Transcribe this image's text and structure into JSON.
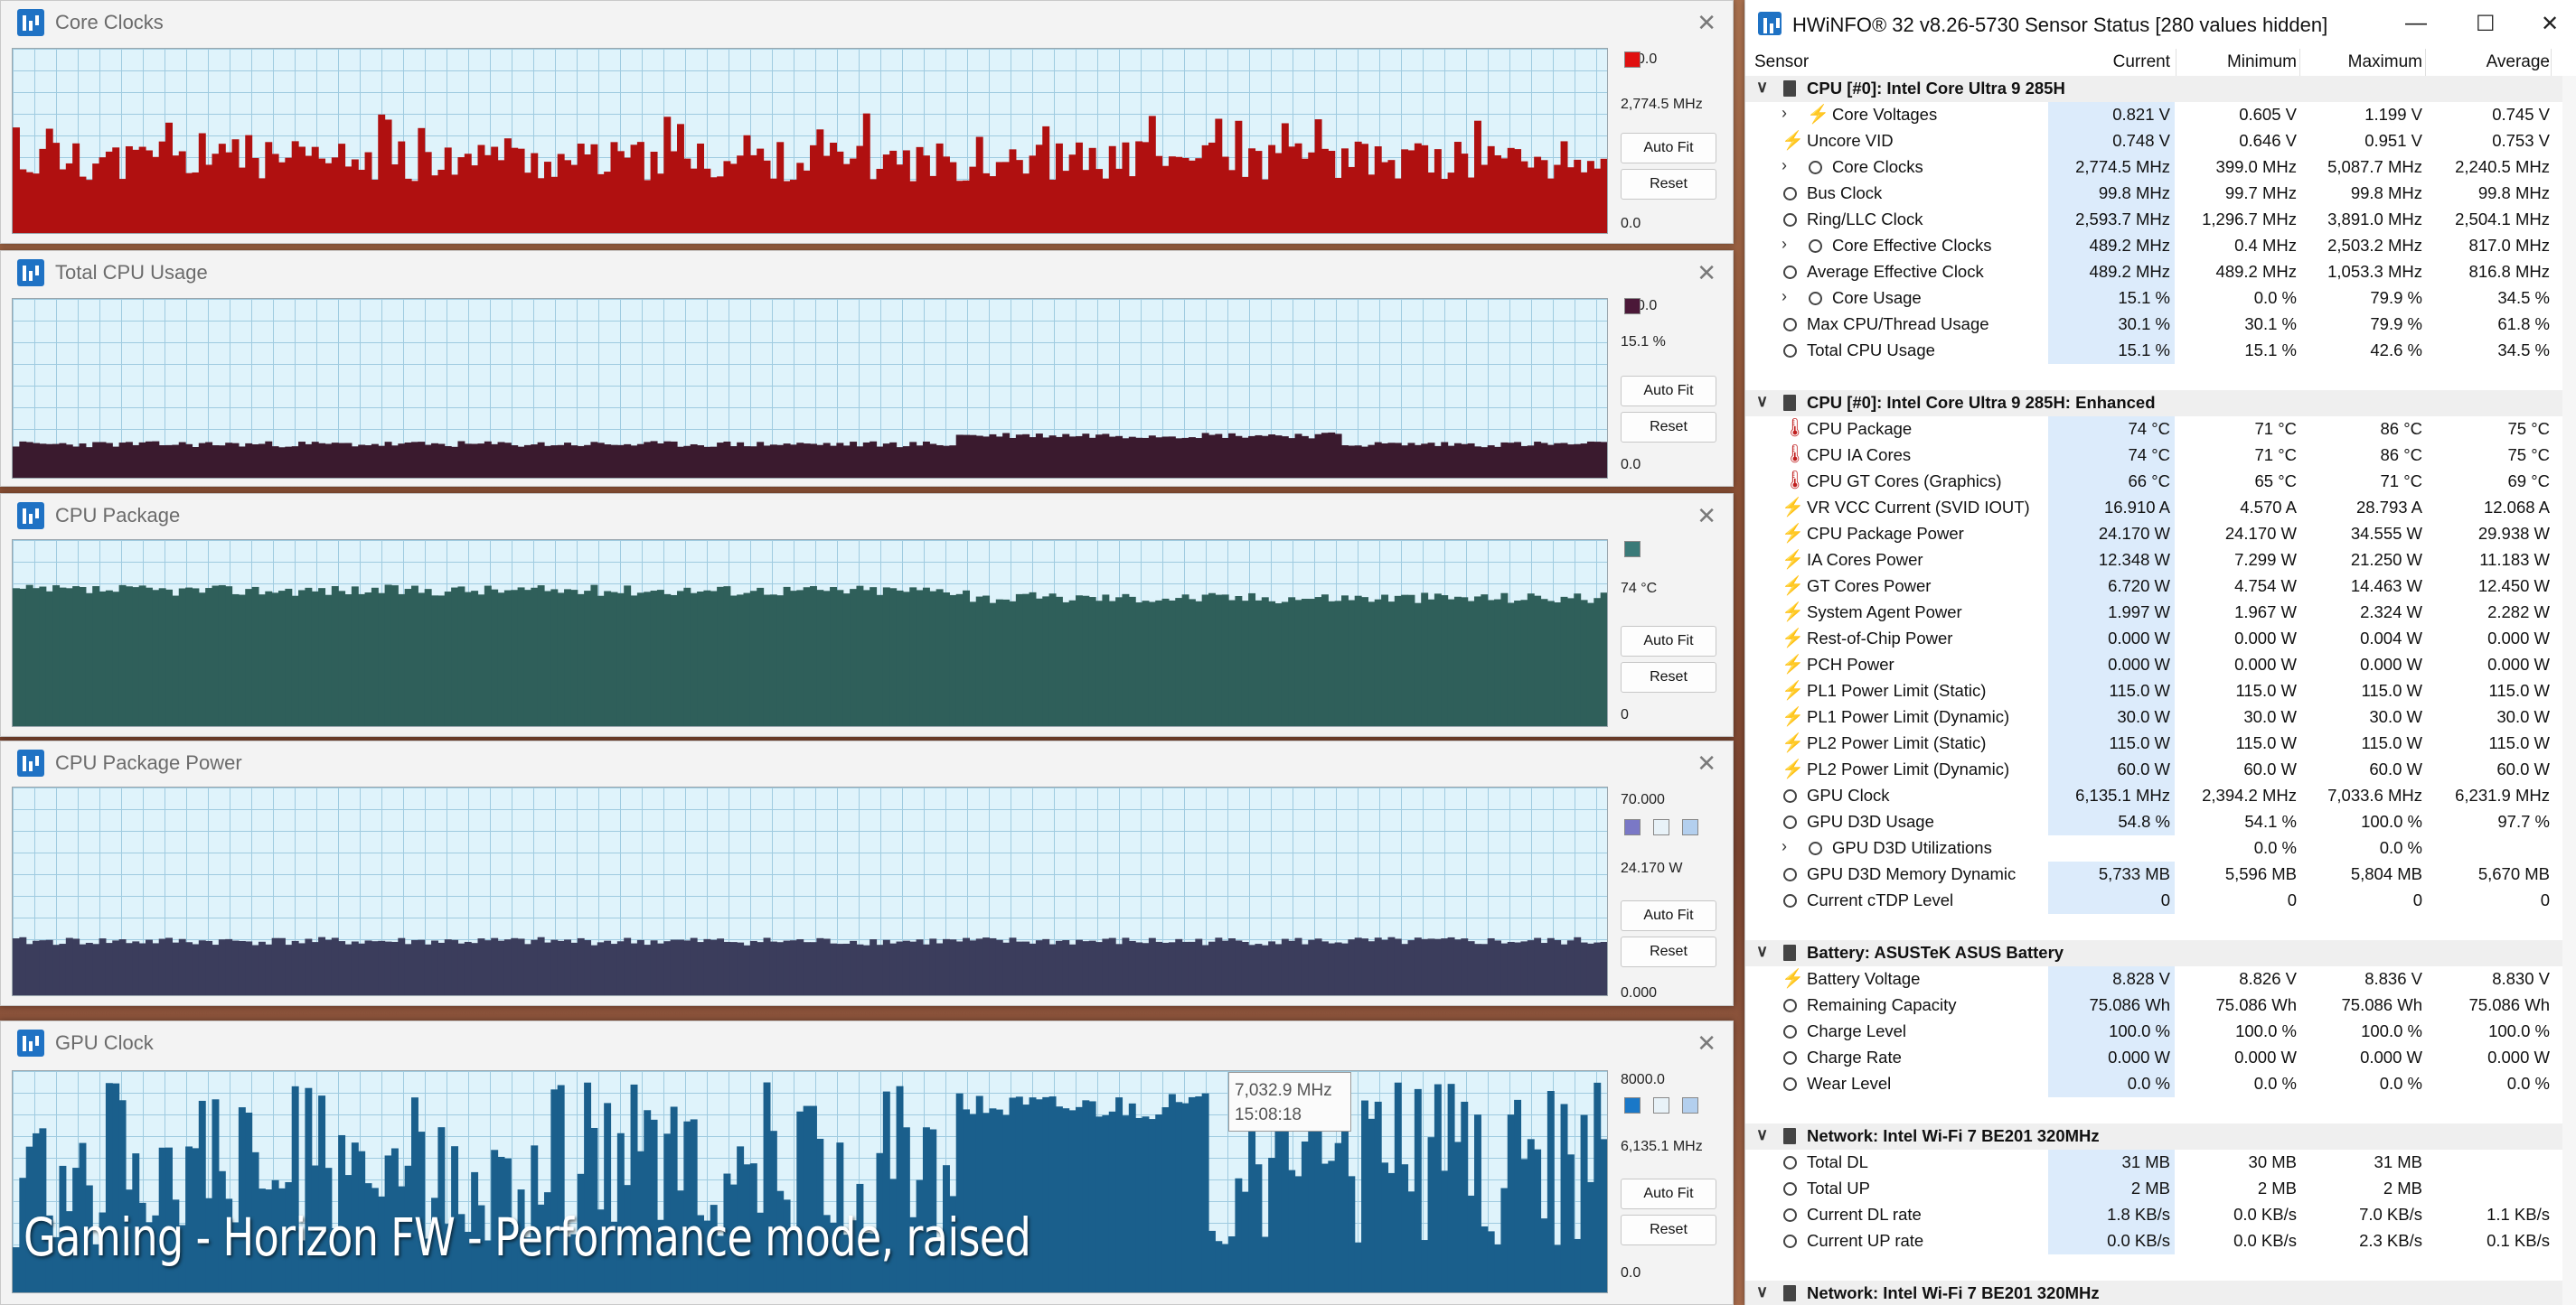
{
  "graphs": [
    {
      "title": "Core Clocks",
      "top_label": "0.0",
      "value_label": "2,774.5 MHz",
      "bottom_label": "0.0",
      "auto_fit": "Auto Fit",
      "reset": "Reset",
      "color": "#b01010"
    },
    {
      "title": "Total CPU Usage",
      "top_label": "0.0",
      "value_label": "15.1 %",
      "bottom_label": "0.0",
      "auto_fit": "Auto Fit",
      "reset": "Reset",
      "color": "#3a1a2e"
    },
    {
      "title": "CPU Package",
      "top_label": "",
      "value_label": "74 °C",
      "bottom_label": "0",
      "auto_fit": "Auto Fit",
      "reset": "Reset",
      "color": "#2f5f5a"
    },
    {
      "title": "CPU Package Power",
      "top_label": "70.000",
      "value_label": "24.170 W",
      "bottom_label": "0.000",
      "auto_fit": "Auto Fit",
      "reset": "Reset",
      "color": "#3b3d5c"
    },
    {
      "title": "GPU Clock",
      "top_label": "8000.0",
      "value_label": "6,135.1 MHz",
      "bottom_label": "0.0",
      "auto_fit": "Auto Fit",
      "reset": "Reset",
      "color": "#1a5f8c"
    }
  ],
  "tooltip": {
    "value": "7,032.9 MHz",
    "time": "15:08:18"
  },
  "caption": "Gaming - Horizon FW - Performance mode, raised",
  "sensor": {
    "title": "HWiNFO® 32 v8.26-5730 Sensor Status [280 values hidden]",
    "columns": {
      "sensor": "Sensor",
      "current": "Current",
      "minimum": "Minimum",
      "maximum": "Maximum",
      "average": "Average"
    },
    "rows": [
      {
        "type": "section",
        "label": "CPU [#0]: Intel Core Ultra 9 285H"
      },
      {
        "exp": true,
        "icon": "bolt",
        "label": "Core Voltages",
        "cur": "0.821 V",
        "min": "0.605 V",
        "max": "1.199 V",
        "avg": "0.745 V"
      },
      {
        "icon": "bolt",
        "label": "Uncore VID",
        "cur": "0.748 V",
        "min": "0.646 V",
        "max": "0.951 V",
        "avg": "0.753 V"
      },
      {
        "exp": true,
        "icon": "clock",
        "label": "Core Clocks",
        "cur": "2,774.5 MHz",
        "min": "399.0 MHz",
        "max": "5,087.7 MHz",
        "avg": "2,240.5 MHz"
      },
      {
        "icon": "clock",
        "label": "Bus Clock",
        "cur": "99.8 MHz",
        "min": "99.7 MHz",
        "max": "99.8 MHz",
        "avg": "99.8 MHz"
      },
      {
        "icon": "clock",
        "label": "Ring/LLC Clock",
        "cur": "2,593.7 MHz",
        "min": "1,296.7 MHz",
        "max": "3,891.0 MHz",
        "avg": "2,504.1 MHz"
      },
      {
        "exp": true,
        "icon": "clock",
        "label": "Core Effective Clocks",
        "cur": "489.2 MHz",
        "min": "0.4 MHz",
        "max": "2,503.2 MHz",
        "avg": "817.0 MHz"
      },
      {
        "icon": "clock",
        "label": "Average Effective Clock",
        "cur": "489.2 MHz",
        "min": "489.2 MHz",
        "max": "1,053.3 MHz",
        "avg": "816.8 MHz"
      },
      {
        "exp": true,
        "icon": "clock",
        "label": "Core Usage",
        "cur": "15.1 %",
        "min": "0.0 %",
        "max": "79.9 %",
        "avg": "34.5 %"
      },
      {
        "icon": "clock",
        "label": "Max CPU/Thread Usage",
        "cur": "30.1 %",
        "min": "30.1 %",
        "max": "79.9 %",
        "avg": "61.8 %"
      },
      {
        "icon": "clock",
        "label": "Total CPU Usage",
        "cur": "15.1 %",
        "min": "15.1 %",
        "max": "42.6 %",
        "avg": "34.5 %"
      },
      {
        "type": "blank"
      },
      {
        "type": "section",
        "label": "CPU [#0]: Intel Core Ultra 9 285H: Enhanced"
      },
      {
        "icon": "therm",
        "label": "CPU Package",
        "cur": "74 °C",
        "min": "71 °C",
        "max": "86 °C",
        "avg": "75 °C"
      },
      {
        "icon": "therm",
        "label": "CPU IA Cores",
        "cur": "74 °C",
        "min": "71 °C",
        "max": "86 °C",
        "avg": "75 °C"
      },
      {
        "icon": "therm",
        "label": "CPU GT Cores (Graphics)",
        "cur": "66 °C",
        "min": "65 °C",
        "max": "71 °C",
        "avg": "69 °C"
      },
      {
        "icon": "bolt",
        "label": "VR VCC Current (SVID IOUT)",
        "cur": "16.910 A",
        "min": "4.570 A",
        "max": "28.793 A",
        "avg": "12.068 A"
      },
      {
        "icon": "bolt",
        "label": "CPU Package Power",
        "cur": "24.170 W",
        "min": "24.170 W",
        "max": "34.555 W",
        "avg": "29.938 W"
      },
      {
        "icon": "bolt",
        "label": "IA Cores Power",
        "cur": "12.348 W",
        "min": "7.299 W",
        "max": "21.250 W",
        "avg": "11.183 W"
      },
      {
        "icon": "bolt",
        "label": "GT Cores Power",
        "cur": "6.720 W",
        "min": "4.754 W",
        "max": "14.463 W",
        "avg": "12.450 W"
      },
      {
        "icon": "bolt",
        "label": "System Agent Power",
        "cur": "1.997 W",
        "min": "1.967 W",
        "max": "2.324 W",
        "avg": "2.282 W"
      },
      {
        "icon": "bolt",
        "label": "Rest-of-Chip Power",
        "cur": "0.000 W",
        "min": "0.000 W",
        "max": "0.004 W",
        "avg": "0.000 W"
      },
      {
        "icon": "bolt",
        "label": "PCH Power",
        "cur": "0.000 W",
        "min": "0.000 W",
        "max": "0.000 W",
        "avg": "0.000 W"
      },
      {
        "icon": "bolt",
        "label": "PL1 Power Limit (Static)",
        "cur": "115.0 W",
        "min": "115.0 W",
        "max": "115.0 W",
        "avg": "115.0 W"
      },
      {
        "icon": "bolt",
        "label": "PL1 Power Limit (Dynamic)",
        "cur": "30.0 W",
        "min": "30.0 W",
        "max": "30.0 W",
        "avg": "30.0 W"
      },
      {
        "icon": "bolt",
        "label": "PL2 Power Limit (Static)",
        "cur": "115.0 W",
        "min": "115.0 W",
        "max": "115.0 W",
        "avg": "115.0 W"
      },
      {
        "icon": "bolt",
        "label": "PL2 Power Limit (Dynamic)",
        "cur": "60.0 W",
        "min": "60.0 W",
        "max": "60.0 W",
        "avg": "60.0 W"
      },
      {
        "icon": "clock",
        "label": "GPU Clock",
        "cur": "6,135.1 MHz",
        "min": "2,394.2 MHz",
        "max": "7,033.6 MHz",
        "avg": "6,231.9 MHz"
      },
      {
        "icon": "clock",
        "label": "GPU D3D Usage",
        "cur": "54.8 %",
        "min": "54.1 %",
        "max": "100.0 %",
        "avg": "97.7 %"
      },
      {
        "exp": true,
        "icon": "clock",
        "label": "GPU D3D Utilizations",
        "cur": "",
        "min": "0.0 %",
        "max": "0.0 %",
        "avg": ""
      },
      {
        "icon": "clock",
        "label": "GPU D3D Memory Dynamic",
        "cur": "5,733 MB",
        "min": "5,596 MB",
        "max": "5,804 MB",
        "avg": "5,670 MB"
      },
      {
        "icon": "clock",
        "label": "Current cTDP Level",
        "cur": "0",
        "min": "0",
        "max": "0",
        "avg": "0"
      },
      {
        "type": "blank"
      },
      {
        "type": "section",
        "label": "Battery: ASUSTeK ASUS Battery"
      },
      {
        "icon": "bolt",
        "label": "Battery Voltage",
        "cur": "8.828 V",
        "min": "8.826 V",
        "max": "8.836 V",
        "avg": "8.830 V"
      },
      {
        "icon": "clock",
        "label": "Remaining Capacity",
        "cur": "75.086 Wh",
        "min": "75.086 Wh",
        "max": "75.086 Wh",
        "avg": "75.086 Wh"
      },
      {
        "icon": "clock",
        "label": "Charge Level",
        "cur": "100.0 %",
        "min": "100.0 %",
        "max": "100.0 %",
        "avg": "100.0 %"
      },
      {
        "icon": "clock",
        "label": "Charge Rate",
        "cur": "0.000 W",
        "min": "0.000 W",
        "max": "0.000 W",
        "avg": "0.000 W"
      },
      {
        "icon": "clock",
        "label": "Wear Level",
        "cur": "0.0 %",
        "min": "0.0 %",
        "max": "0.0 %",
        "avg": "0.0 %"
      },
      {
        "type": "blank"
      },
      {
        "type": "section",
        "label": "Network: Intel Wi-Fi 7 BE201 320MHz"
      },
      {
        "icon": "clock",
        "label": "Total DL",
        "cur": "31 MB",
        "min": "30 MB",
        "max": "31 MB",
        "avg": ""
      },
      {
        "icon": "clock",
        "label": "Total UP",
        "cur": "2 MB",
        "min": "2 MB",
        "max": "2 MB",
        "avg": ""
      },
      {
        "icon": "clock",
        "label": "Current DL rate",
        "cur": "1.8 KB/s",
        "min": "0.0 KB/s",
        "max": "7.0 KB/s",
        "avg": "1.1 KB/s"
      },
      {
        "icon": "clock",
        "label": "Current UP rate",
        "cur": "0.0 KB/s",
        "min": "0.0 KB/s",
        "max": "2.3 KB/s",
        "avg": "0.1 KB/s"
      },
      {
        "type": "blank"
      },
      {
        "type": "section",
        "label": "Network: Intel Wi-Fi 7 BE201 320MHz"
      }
    ]
  }
}
